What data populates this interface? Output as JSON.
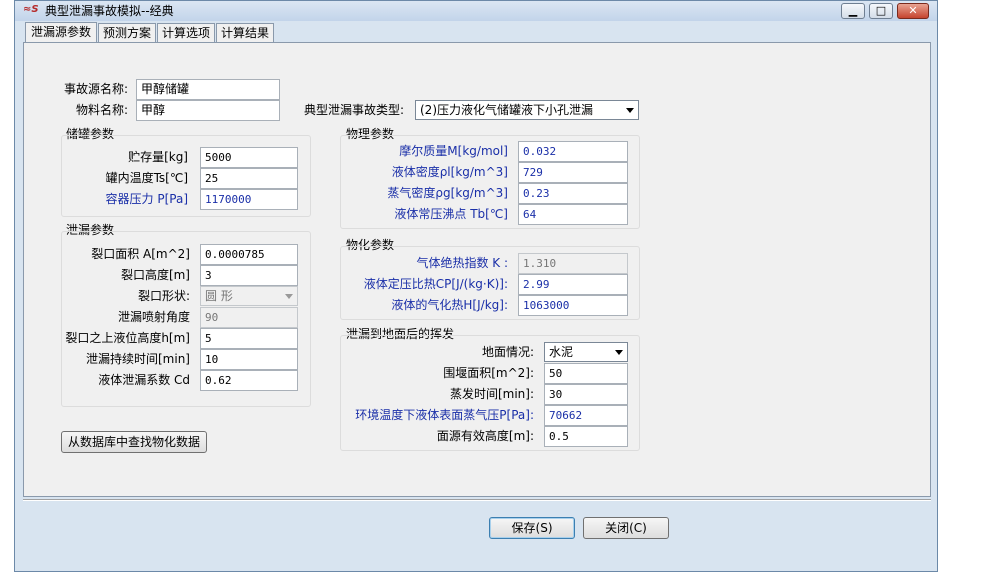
{
  "window": {
    "title": "典型泄漏事故模拟--经典",
    "min": "▭",
    "max": "□",
    "close": "✕"
  },
  "tabs": [
    {
      "label": "泄漏源参数"
    },
    {
      "label": "预测方案"
    },
    {
      "label": "计算选项"
    },
    {
      "label": "计算结果"
    }
  ],
  "source": {
    "name_label": "事故源名称:",
    "name_value": "甲醇储罐",
    "material_label": "物料名称:",
    "material_value": "甲醇",
    "type_label": "典型泄漏事故类型:",
    "type_value": "(2)压力液化气储罐液下小孔泄漏"
  },
  "tank": {
    "title": "储罐参数",
    "fields": [
      {
        "label": "贮存量[kg]",
        "value": "5000"
      },
      {
        "label": "罐内温度Ts[℃]",
        "value": "25"
      },
      {
        "label": "容器压力 P[Pa]",
        "value": "1170000"
      }
    ]
  },
  "leak": {
    "title": "泄漏参数",
    "area_label": "裂口面积 A[m^2]",
    "area_value": "0.0000785",
    "height_label": "裂口高度[m]",
    "height_value": "3",
    "shape_label": "裂口形状:",
    "shape_value": "圆  形",
    "angle_label": "泄漏喷射角度",
    "angle_value": "90",
    "level_label": "裂口之上液位高度h[m]",
    "level_value": "5",
    "duration_label": "泄漏持续时间[min]",
    "duration_value": "10",
    "coef_label": "液体泄漏系数  Cd",
    "coef_value": "0.62"
  },
  "physical": {
    "title": "物理参数",
    "fields": [
      {
        "label": "摩尔质量M[kg/mol]",
        "value": "0.032"
      },
      {
        "label": "液体密度ρl[kg/m^3]",
        "value": "729"
      },
      {
        "label": "蒸气密度ρg[kg/m^3]",
        "value": "0.23"
      },
      {
        "label": "液体常压沸点 Tb[℃]",
        "value": "64"
      }
    ]
  },
  "chemical": {
    "title": "物化参数",
    "fields": [
      {
        "label": "气体绝热指数  K :",
        "value": "1.310"
      },
      {
        "label": "液体定压比热CP[J/(kg·K)]:",
        "value": "2.99"
      },
      {
        "label": "液体的气化热H[J/kg]:",
        "value": "1063000"
      }
    ]
  },
  "evaporation": {
    "title": "泄漏到地面后的挥发",
    "ground_label": "地面情况:",
    "ground_value": "水泥",
    "fields": [
      {
        "label": "围堰面积[m^2]:",
        "value": "50"
      },
      {
        "label": "蒸发时间[min]:",
        "value": "30"
      },
      {
        "label": "环境温度下液体表面蒸气压P[Pa]:",
        "value": "70662"
      },
      {
        "label": "面源有效高度[m]:",
        "value": "0.5"
      }
    ]
  },
  "db_button": "从数据库中查找物化数据",
  "buttons": {
    "save": "保存",
    "save_key": "(S)",
    "close": "关闭",
    "close_key": "(C)"
  },
  "colors": {
    "label_blue": "#1a2fa8",
    "window_bg": "#d8e4f0",
    "panel_bg": "#f0f0f0"
  }
}
